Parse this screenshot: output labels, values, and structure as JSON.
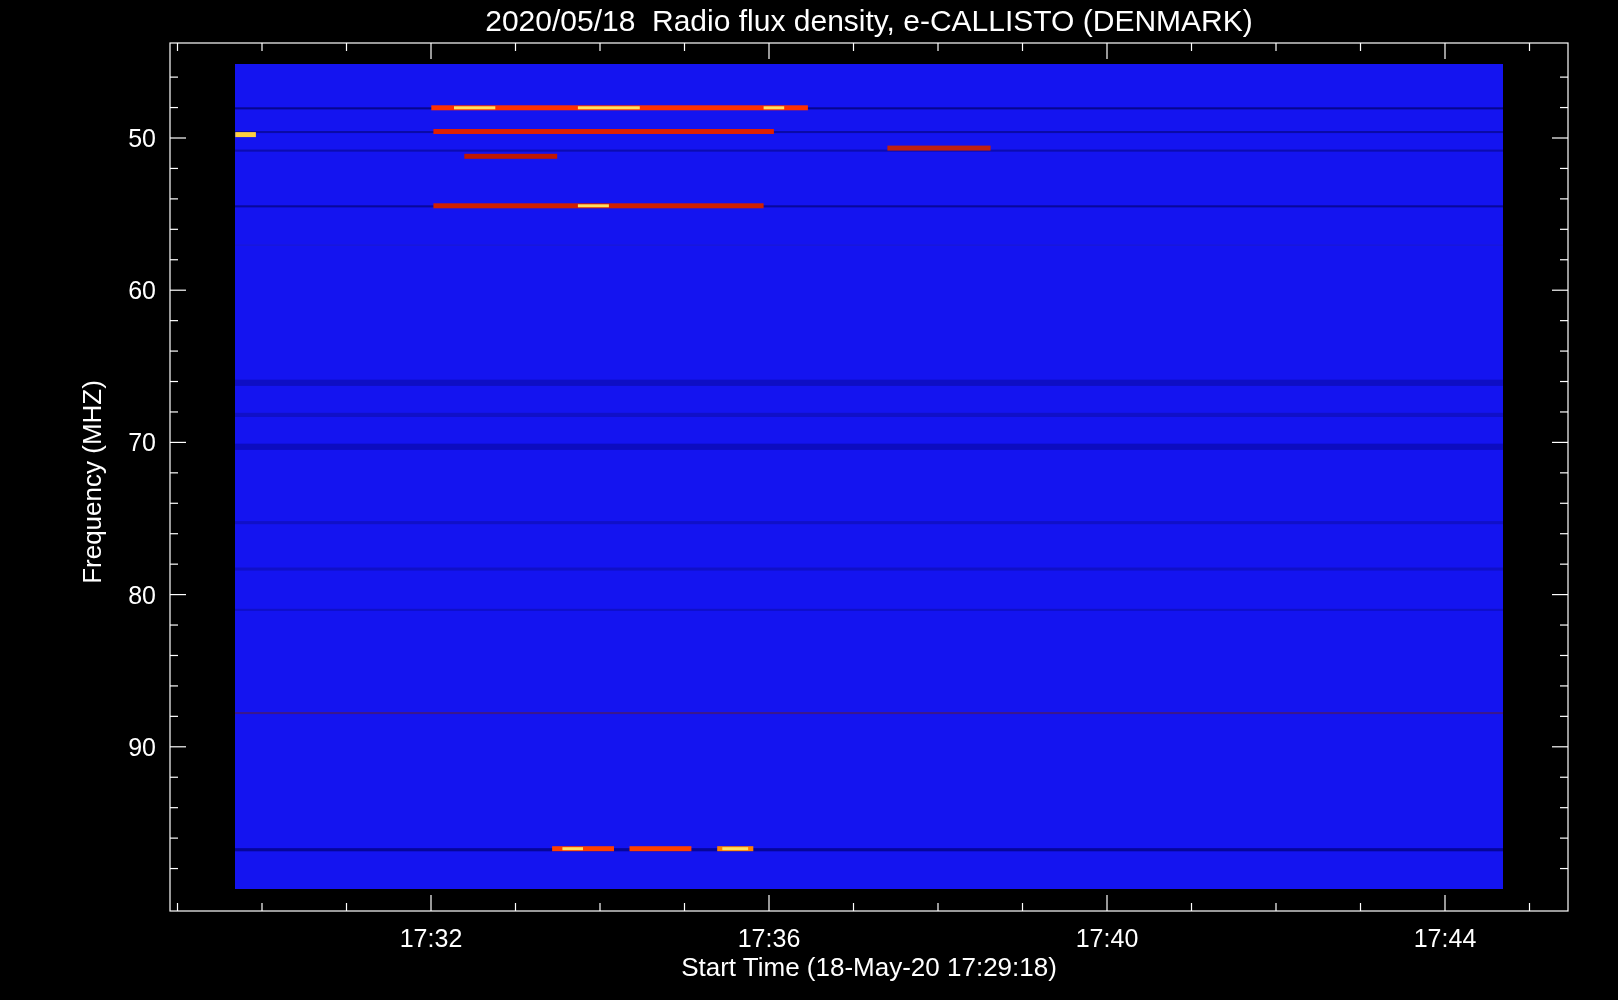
{
  "title": "2020/05/18  Radio flux density, e-CALLISTO (DENMARK)",
  "y_axis": {
    "label": "Frequency (MHZ)",
    "ticks": [
      "50",
      "60",
      "70",
      "80",
      "90"
    ]
  },
  "x_axis": {
    "label": "Start Time (18-May-20 17:29:18)",
    "ticks": [
      "17:32",
      "17:36",
      "17:40",
      "17:44"
    ]
  }
}
